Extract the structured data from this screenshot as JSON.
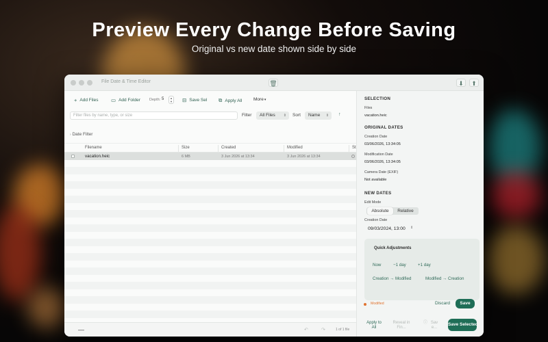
{
  "hero": {
    "title": "Preview Every Change Before Saving",
    "subtitle": "Original vs new date shown side by side"
  },
  "window": {
    "title": "File Date & Time Editor"
  },
  "toolbar": {
    "add_files": "Add Files",
    "add_folder": "Add Folder",
    "depth_label": "Depth:",
    "depth_value": "5",
    "save_sel": "Save Sel",
    "apply_all": "Apply All",
    "more": "More"
  },
  "filter": {
    "search_placeholder": "Filter files by name, type, or size",
    "filter_label": "Filter",
    "filter_value": "All Files",
    "sort_label": "Sort",
    "sort_value": "Name",
    "date_filter": "Date Filter"
  },
  "table": {
    "columns": [
      "Filename",
      "Size",
      "Created",
      "Modified",
      "St"
    ],
    "rows": [
      {
        "filename": "vacation.heic",
        "size": "6 MB",
        "created": "3 Jun 2026 at 13:34",
        "modified": "3 Jun 2026 at 13:34"
      }
    ]
  },
  "footer": {
    "minus": "—",
    "count": "1 of 1 file"
  },
  "inspector": {
    "selection_header": "SELECTION",
    "files_label": "Files",
    "files_value": "vacation.heic",
    "original_header": "ORIGINAL DATES",
    "creation_label": "Creation Date",
    "creation_value": "03/06/2026, 13:34:05",
    "modification_label": "Modification Date",
    "modification_value": "03/06/2026, 13:34:05",
    "camera_label": "Camera Date (EXIF)",
    "camera_value": "Not available",
    "new_header": "NEW DATES",
    "edit_mode_label": "Edit Mode",
    "mode_absolute": "Absolute",
    "mode_relative": "Relative",
    "new_creation_label": "Creation Date",
    "new_creation_value": "09/03/2024, 13:00",
    "quick_title": "Quick Adjustments",
    "qa_now": "Now",
    "qa_minus_day": "−1 day",
    "qa_plus_day": "+1 day",
    "qa_creation_to_modified": "Creation → Modified",
    "qa_modified_to_creation": "Modified → Creation",
    "modified_status": "Modified",
    "discard": "Discard",
    "save": "Save",
    "apply_to_all": "Apply to All",
    "reveal": "Reveal in Fin...",
    "save_dim": "Sav e...",
    "save_selected": "Save Selected"
  },
  "colors": {
    "accent": "#1f6e57",
    "link": "#2f6a58",
    "modified": "#e0732f"
  },
  "icons": [
    "plus-icon",
    "folder-plus-icon",
    "save-icon",
    "apply-icon",
    "chevron-down-icon",
    "trash-icon",
    "export-icon",
    "share-icon",
    "undo-icon",
    "redo-icon",
    "info-icon"
  ]
}
